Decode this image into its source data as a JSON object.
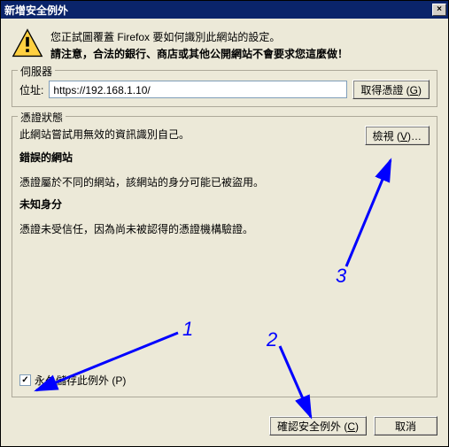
{
  "window": {
    "title": "新增安全例外",
    "close": "×"
  },
  "warning": {
    "line1": "您正試圖覆蓋 Firefox 要如何識別此網站的設定。",
    "line2": "請注意，合法的銀行、商店或其他公開網站不會要求您這麼做！"
  },
  "server": {
    "legend": "伺服器",
    "location_label": "位址:",
    "location_value": "https://192.168.1.10/",
    "get_cert_label": "取得憑證 ",
    "get_cert_accel": "G"
  },
  "status": {
    "legend": "憑證狀態",
    "intro": "此網站嘗試用無效的資訊識別自己。",
    "view_label": "檢視 ",
    "view_accel": "V",
    "view_suffix": "…",
    "wrong_site_heading": "錯誤的網站",
    "wrong_site_text": "憑證屬於不同的網站，該網站的身分可能已被盜用。",
    "unknown_identity_heading": "未知身分",
    "unknown_identity_text": "憑證未受信任，因為尚未被認得的憑證機構驗證。",
    "permanent_label": "永久儲存此例外 ",
    "permanent_accel": "P",
    "permanent_checked": "✓"
  },
  "footer": {
    "confirm_label": "確認安全例外 ",
    "confirm_accel": "C",
    "cancel_label": "取消"
  },
  "annotations": {
    "n1": "1",
    "n2": "2",
    "n3": "3"
  }
}
